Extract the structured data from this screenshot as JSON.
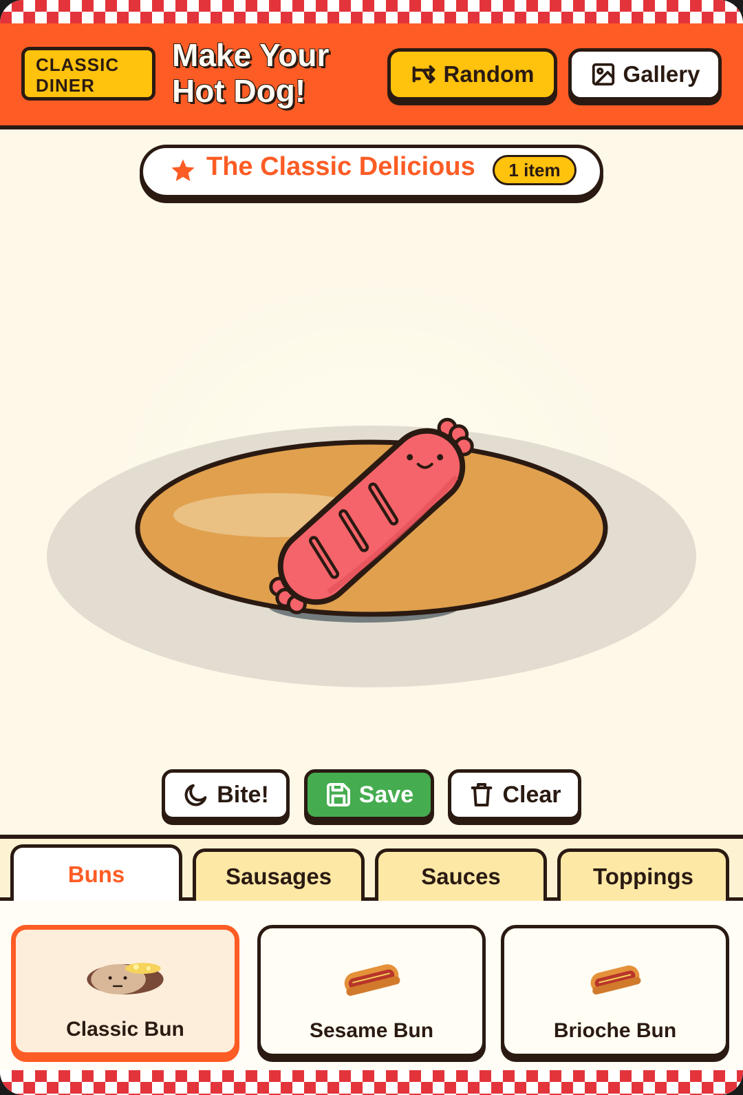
{
  "header": {
    "badge_line1": "CLASSIC",
    "badge_line2": "DINER",
    "title_line1": "Make Your",
    "title_line2": "Hot Dog!",
    "random_label": "Random",
    "gallery_label": "Gallery"
  },
  "creation": {
    "name": "The Classic Delicious",
    "item_count": "1 item"
  },
  "actions": {
    "bite_label": "Bite!",
    "save_label": "Save",
    "clear_label": "Clear"
  },
  "tabs": [
    {
      "label": "Buns",
      "active": true
    },
    {
      "label": "Sausages",
      "active": false
    },
    {
      "label": "Sauces",
      "active": false
    },
    {
      "label": "Toppings",
      "active": false
    }
  ],
  "items": [
    {
      "label": "Classic Bun",
      "selected": true,
      "icon": "classic-bun-icon"
    },
    {
      "label": "Sesame Bun",
      "selected": false,
      "icon": "hotdog-icon"
    },
    {
      "label": "Brioche Bun",
      "selected": false,
      "icon": "hotdog-icon"
    }
  ],
  "colors": {
    "header_orange": "#fd5c25",
    "accent_yellow": "#ffc20d",
    "save_green": "#45ac4f",
    "outline": "#2a1a12",
    "sausage": "#f5646a",
    "plate": "#e0a04d",
    "checker_red": "#e3343b"
  }
}
